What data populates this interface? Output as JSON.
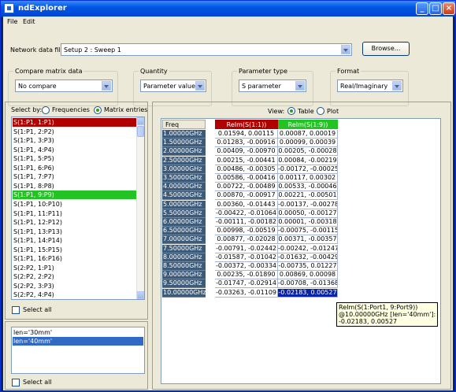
{
  "window": {
    "title": "ndExplorer",
    "icon": "app-icon",
    "controls": {
      "minimize": "_",
      "maximize": "□",
      "close": "×"
    }
  },
  "menu": {
    "file": "File",
    "edit": "Edit"
  },
  "data_file": {
    "label": "Network data file:",
    "value": "Setup 2 : Sweep 1",
    "browse": "Browse..."
  },
  "groups": {
    "compare": {
      "title": "Compare matrix data",
      "value": "No compare"
    },
    "quantity": {
      "title": "Quantity",
      "value": "Parameter values"
    },
    "ptype": {
      "title": "Parameter type",
      "value": "S parameter"
    },
    "format": {
      "title": "Format",
      "value": "Real/Imaginary"
    }
  },
  "select_by": {
    "label": "Select by:",
    "frequencies": "Frequencies",
    "matrix": "Matrix entries",
    "selected": "Matrix entries"
  },
  "entries": {
    "items": [
      "S(1:P1, 1:P1)",
      "S(1:P1, 2:P2)",
      "S(1:P1, 3:P3)",
      "S(1:P1, 4:P4)",
      "S(1:P1, 5:P5)",
      "S(1:P1, 6:P6)",
      "S(1:P1, 7:P7)",
      "S(1:P1, 8:P8)",
      "S(1:P1, 9:P9)",
      "S(1:P1, 10:P10)",
      "S(1:P1, 11:P11)",
      "S(1:P1, 12:P12)",
      "S(1:P1, 13:P13)",
      "S(1:P1, 14:P14)",
      "S(1:P1, 15:P15)",
      "S(1:P1, 16:P16)",
      "S(2:P2, 1:P1)",
      "S(2:P2, 2:P2)",
      "S(2:P2, 3:P3)",
      "S(2:P2, 4:P4)"
    ],
    "highlight_red": 0,
    "highlight_green": 8,
    "red_color": "#b00000",
    "green_color": "#22c322"
  },
  "select_all_1": "Select all",
  "variations": {
    "items": [
      "len='30mm'",
      "len='40mm'"
    ],
    "selected": 1
  },
  "select_all_2": "Select all",
  "view": {
    "label": "View:",
    "table": "Table",
    "plot": "Plot",
    "selected": "Table"
  },
  "table": {
    "headers": [
      "Freq",
      "ReIm(S(1:1))",
      "ReIm(S(1:9))"
    ],
    "header_colors": [
      "",
      "#b00000",
      "#22c322"
    ],
    "rows": [
      [
        "1.00000GHz",
        "0.01594, 0.00115",
        "0.00087, 0.00019"
      ],
      [
        "1.50000GHz",
        "0.01283, -0.00916",
        "0.00099, 0.00039"
      ],
      [
        "2.00000GHz",
        "0.00409, -0.00970",
        "0.00205, -0.00028"
      ],
      [
        "2.50000GHz",
        "0.00215, -0.00441",
        "0.00084, -0.00219"
      ],
      [
        "3.00000GHz",
        "0.00486, -0.00305",
        "-0.00172, -0.00025"
      ],
      [
        "3.50000GHz",
        "0.00586, -0.00416",
        "0.00117, 0.00302"
      ],
      [
        "4.00000GHz",
        "0.00722, -0.00489",
        "0.00533, -0.00046"
      ],
      [
        "4.50000GHz",
        "0.00870, -0.00917",
        "0.00221, -0.00501"
      ],
      [
        "5.00000GHz",
        "0.00360, -0.01443",
        "-0.00137, -0.00278"
      ],
      [
        "5.50000GHz",
        "-0.00422, -0.01064",
        "0.00050, -0.00127"
      ],
      [
        "6.00000GHz",
        "-0.00111, -0.00182",
        "0.00001, -0.00318"
      ],
      [
        "6.50000GHz",
        "0.00998, -0.00519",
        "-0.00075, -0.00115"
      ],
      [
        "7.00000GHz",
        "0.00877, -0.02028",
        "0.00371, -0.00357"
      ],
      [
        "7.50000GHz",
        "-0.00791, -0.02442",
        "-0.00242, -0.01247"
      ],
      [
        "8.00000GHz",
        "-0.01587, -0.01042",
        "-0.01632, -0.00429"
      ],
      [
        "8.50000GHz",
        "-0.00372, -0.00334",
        "-0.00735, 0.01227"
      ],
      [
        "9.00000GHz",
        "0.00235, -0.01890",
        "0.00869, 0.00098"
      ],
      [
        "9.50000GHz",
        "-0.01747, -0.02914",
        "-0.00708, -0.01368"
      ],
      [
        "10.00000GHz",
        "-0.03263, -0.01109",
        "-0.02183, 0.00527"
      ]
    ],
    "selected_row": 18,
    "selected_col": 2
  },
  "tooltip": {
    "line1": "ReIm(S(1:Port1, 9:Port9))",
    "line2": "@10.00000GHz [len='40mm']:",
    "line3": "-0.02183, 0.00527"
  }
}
